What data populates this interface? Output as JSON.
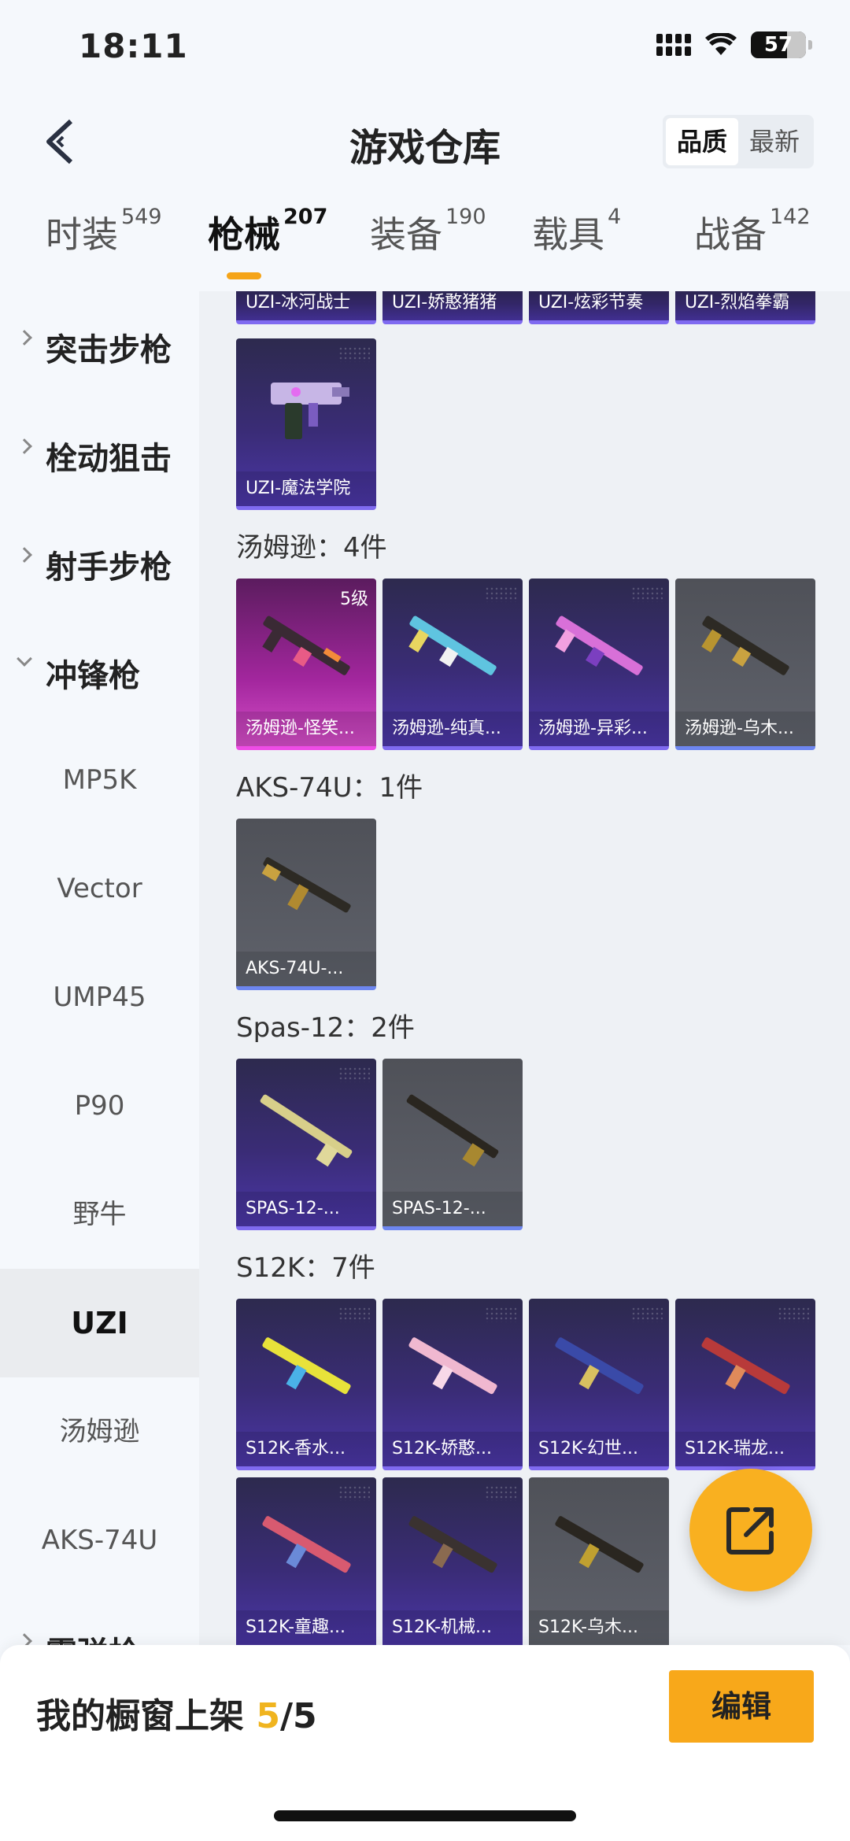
{
  "status_bar": {
    "time": "18:11",
    "battery": "57"
  },
  "header": {
    "title": "游戏仓库",
    "sort_options": [
      "品质",
      "最新"
    ],
    "sort_selected": "品质"
  },
  "tabs": [
    {
      "label": "时装",
      "count": "549"
    },
    {
      "label": "枪械",
      "count": "207"
    },
    {
      "label": "装备",
      "count": "190"
    },
    {
      "label": "载具",
      "count": "4"
    },
    {
      "label": "战备",
      "count": "142"
    }
  ],
  "active_tab": "枪械",
  "sidebar": {
    "categories": [
      {
        "label": "突击步枪",
        "expanded": false
      },
      {
        "label": "栓动狙击",
        "expanded": false
      },
      {
        "label": "射手步枪",
        "expanded": false
      },
      {
        "label": "冲锋枪",
        "expanded": true
      },
      {
        "label": "霰弹枪",
        "expanded": false
      }
    ],
    "subitems": [
      "MP5K",
      "Vector",
      "UMP45",
      "P90",
      "野牛",
      "UZI",
      "汤姆逊",
      "AKS-74U"
    ],
    "selected": "UZI"
  },
  "uzi_top_row": [
    "UZI-冰河战士",
    "UZI-娇憨猪猪",
    "UZI-炫彩节奏",
    "UZI-烈焰拳霸"
  ],
  "uzi_items": [
    "UZI-魔法学院"
  ],
  "sections": [
    {
      "title": "汤姆逊：4件",
      "items": [
        {
          "name": "汤姆逊-怪笑...",
          "level": "5级",
          "quality": "pink"
        },
        {
          "name": "汤姆逊-纯真...",
          "quality": "purple"
        },
        {
          "name": "汤姆逊-异彩...",
          "quality": "purple"
        },
        {
          "name": "汤姆逊-乌木...",
          "quality": "grey"
        }
      ]
    },
    {
      "title": "AKS-74U：1件",
      "items": [
        {
          "name": "AKS-74U-...",
          "quality": "grey"
        }
      ]
    },
    {
      "title": "Spas-12：2件",
      "items": [
        {
          "name": "SPAS-12-...",
          "quality": "purple"
        },
        {
          "name": "SPAS-12-...",
          "quality": "grey"
        }
      ]
    },
    {
      "title": "S12K：7件",
      "items": [
        {
          "name": "S12K-香水...",
          "quality": "purple"
        },
        {
          "name": "S12K-娇憨...",
          "quality": "purple"
        },
        {
          "name": "S12K-幻世...",
          "quality": "purple"
        },
        {
          "name": "S12K-瑞龙...",
          "quality": "purple"
        },
        {
          "name": "S12K-童趣...",
          "quality": "purple"
        },
        {
          "name": "S12K-机械...",
          "quality": "purple"
        },
        {
          "name": "S12K-乌木...",
          "quality": "grey"
        }
      ]
    }
  ],
  "bottom_bar": {
    "label": "我的橱窗上架",
    "current": "5",
    "total": "/5",
    "edit_label": "编辑"
  },
  "colors": {
    "accent": "#f8a81a",
    "purple_card": "#3a2c76",
    "pink_card": "#a2269d",
    "grey_card": "#5f626b"
  },
  "icons": {
    "back": "chevron-left-icon",
    "share": "share-external-icon"
  }
}
